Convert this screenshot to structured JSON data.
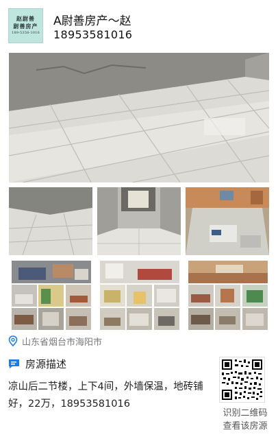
{
  "header": {
    "logo_line1": "赵尉善",
    "logo_line2": "尉善房产",
    "logo_line3": "189-5358-1016",
    "agent_name": "A尉善房产～赵",
    "agent_phone": "18953581016"
  },
  "listing": {
    "location": "山东省烟台市海阳市",
    "section_title": "房源描述",
    "description": "凉山后二节楼，上下4间，外墙保温，地砖铺好，22万，18953581016"
  },
  "qr": {
    "caption_line1": "识别二维码",
    "caption_line2": "查看该房源"
  },
  "icons": {
    "location": "map-pin-icon",
    "description": "chat-bubble-icon",
    "qr": "qr-code-icon"
  },
  "colors": {
    "logo_bg": "#bfe5df",
    "accent_blue": "#1e7be0"
  }
}
